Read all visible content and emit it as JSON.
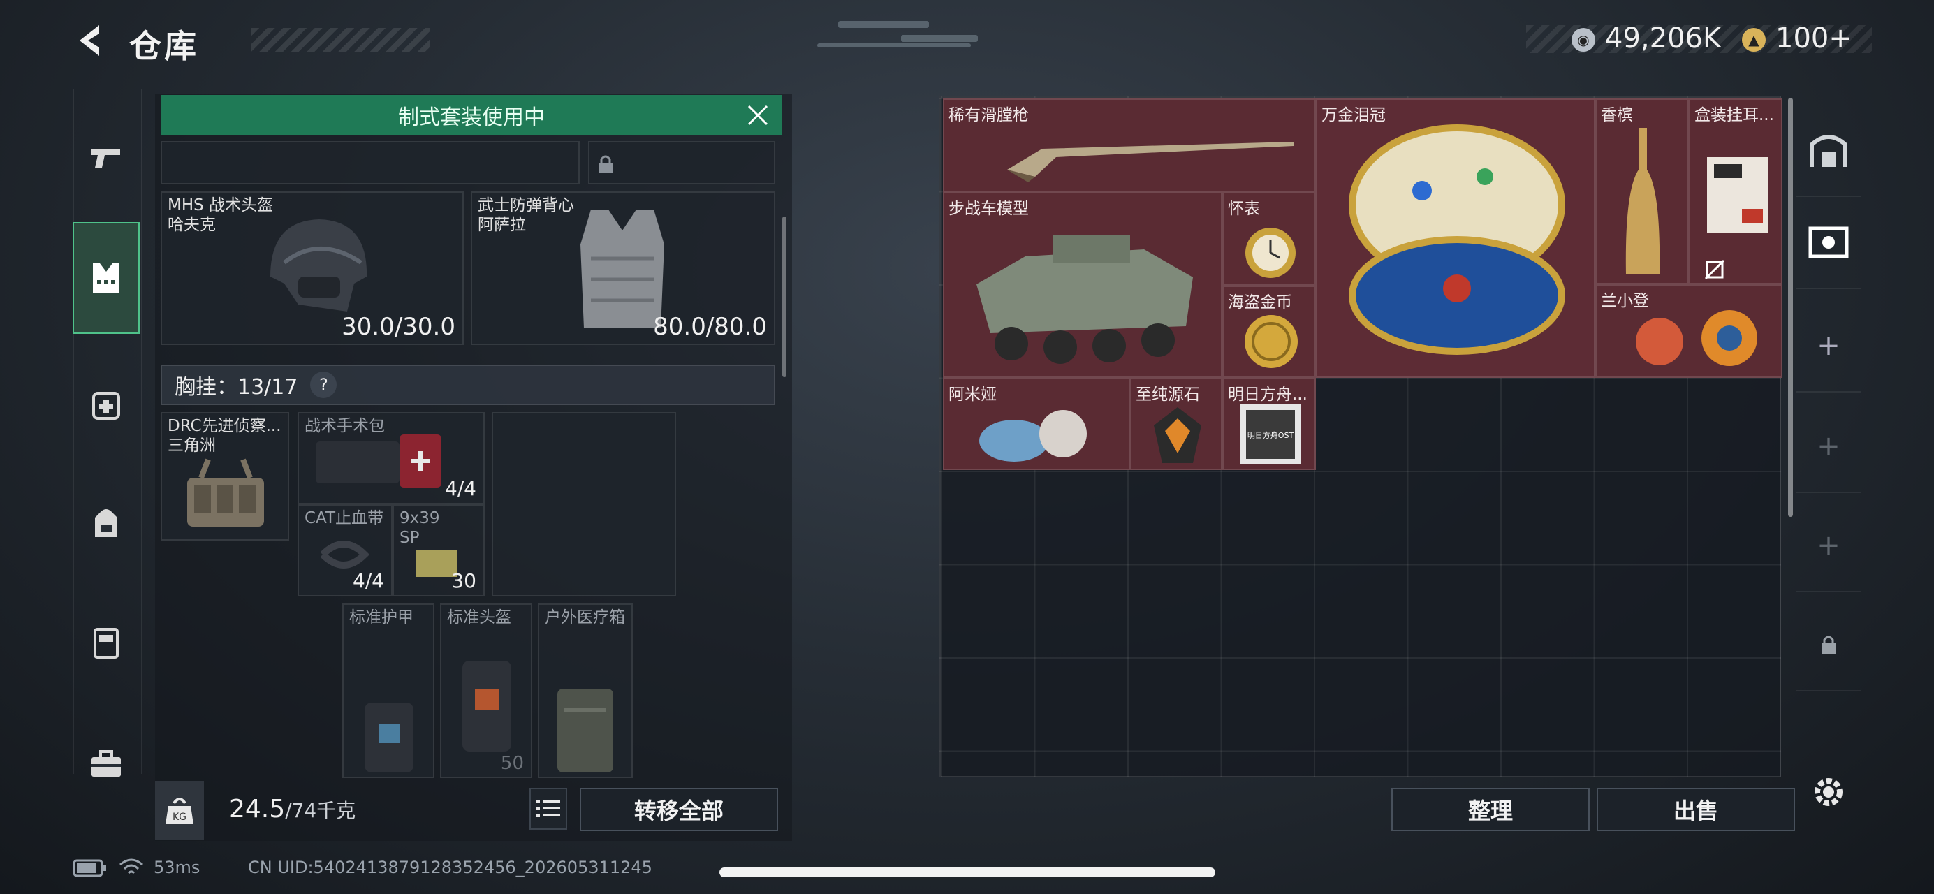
{
  "header": {
    "title": "仓库"
  },
  "currency": {
    "coins": "49,206K",
    "tokens": "100+"
  },
  "loadout": {
    "banner": "制式套装使用中",
    "helmet": {
      "name": "MHS 战术头盔",
      "sub": "哈夫克",
      "durability": "30.0/30.0"
    },
    "armor": {
      "name": "武士防弹背心",
      "sub": "阿萨拉",
      "durability": "80.0/80.0"
    },
    "chest_rig": {
      "label": "胸挂：13/17",
      "help": "?"
    },
    "rig_item": {
      "name": "DRC先进侦察...",
      "sub": "三角洲"
    },
    "rig_slots": [
      {
        "name": "战术手术包",
        "count": "4/4"
      },
      {
        "name": "CAT止血带",
        "count": "4/4"
      },
      {
        "name": "9x39",
        "sub": "SP",
        "count": "30"
      }
    ],
    "standard_slots": [
      {
        "name": "标准护甲"
      },
      {
        "name": "标准头盔",
        "extra": "50"
      },
      {
        "name": "户外医疗箱"
      }
    ],
    "weight": {
      "current": "24.5",
      "max": "/74千克",
      "kg_icon": "KG"
    },
    "transfer_all": "转移全部"
  },
  "warehouse": {
    "items": [
      {
        "name": "稀有滑膛枪",
        "icon": "musket"
      },
      {
        "name": "万金泪冠",
        "icon": "jeweled-egg"
      },
      {
        "name": "香槟",
        "icon": "champagne"
      },
      {
        "name": "盒装挂耳...",
        "icon": "coffee-box"
      },
      {
        "name": "步战车模型",
        "icon": "vehicle-model"
      },
      {
        "name": "怀表",
        "icon": "pocket-watch"
      },
      {
        "name": "海盗金币",
        "icon": "gold-coin"
      },
      {
        "name": "兰小登",
        "icon": "toy-figure"
      },
      {
        "name": "阿米娅",
        "icon": "figure"
      },
      {
        "name": "至纯源石",
        "icon": "crystal"
      },
      {
        "name": "明日方舟...",
        "icon": "album",
        "art_text": "明日方舟OST"
      }
    ],
    "sort_button": "整理",
    "sell_button": "出售"
  },
  "status_bar": {
    "ping": "53ms",
    "uid": "CN UID:5402413879128352456_202605311245"
  },
  "colors": {
    "accent_green": "#1f7a56",
    "item_red": "#5a2b33"
  }
}
